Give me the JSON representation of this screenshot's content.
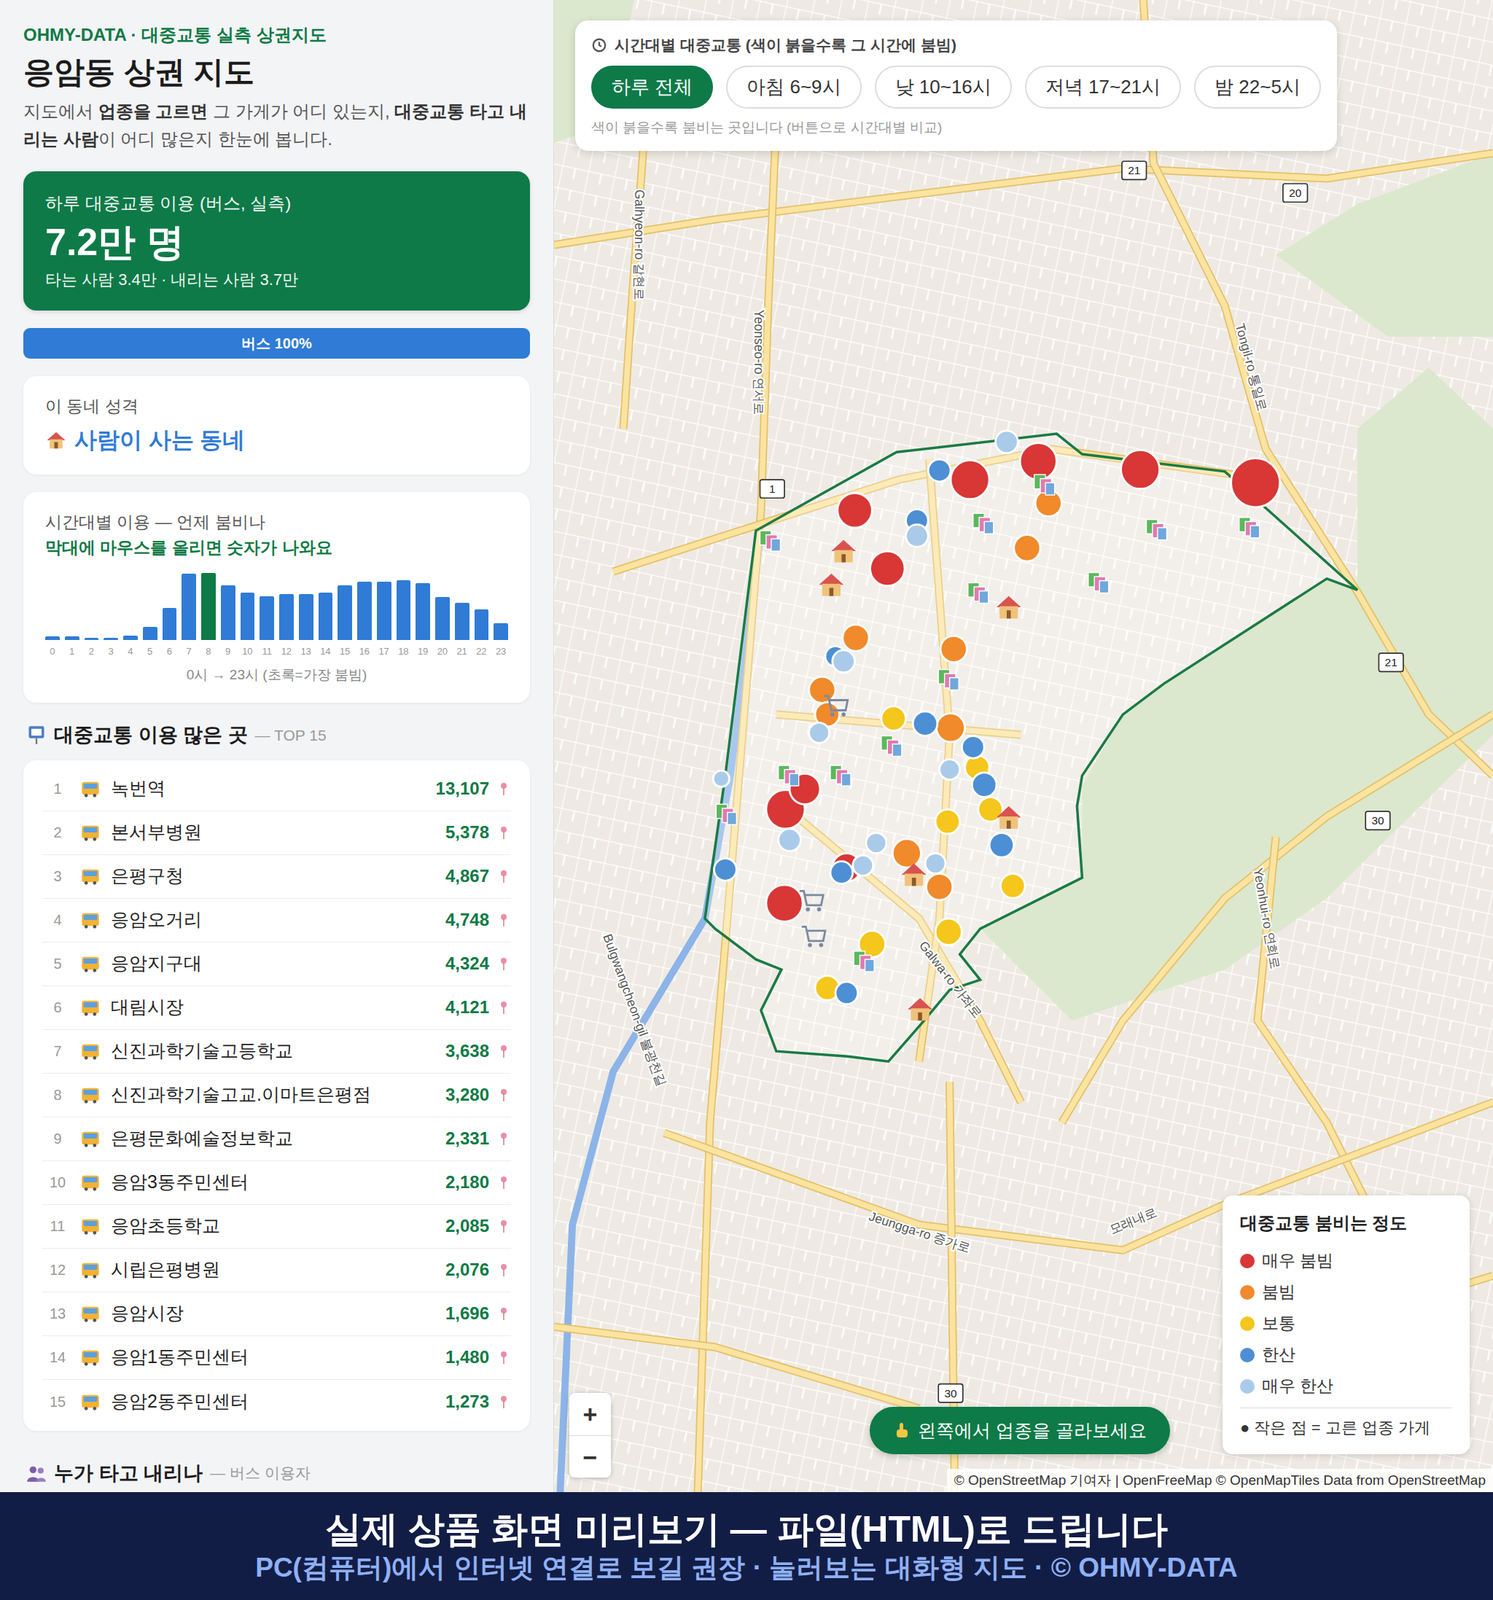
{
  "sidebar": {
    "brand": "OHMY-DATA · 대중교통 실측 상권지도",
    "title": "응암동 상권 지도",
    "description": [
      {
        "text": "지도에서 ",
        "bold": false
      },
      {
        "text": "업종을 고르면",
        "bold": true
      },
      {
        "text": " 그 가게가 어디 있는지, ",
        "bold": false
      },
      {
        "text": "대중교통 타고 내리는 사람",
        "bold": true
      },
      {
        "text": "이 어디 많은지 한눈에 봅니다.",
        "bold": false
      }
    ],
    "summary": {
      "label": "하루 대중교통 이용 (버스, 실측)",
      "value": "7.2만 명",
      "detail": "타는 사람 3.4만 · 내리는 사람 3.7만"
    },
    "mode_share": [
      {
        "label": "버스 100%",
        "level": 1,
        "color": "#2f7bd6"
      }
    ],
    "character": {
      "label": "이 동네 성격",
      "value": "사람이 사는 동네"
    },
    "hourly_chart": {
      "title": "시간대별 이용 — 언제 붐비나",
      "hint": "막대에 마우스를 올리면 숫자가 나와요",
      "bars": [
        {
          "hour": "0",
          "value": 300,
          "peak": false
        },
        {
          "hour": "1",
          "value": 300,
          "peak": false
        },
        {
          "hour": "2",
          "value": 200,
          "peak": false
        },
        {
          "hour": "3",
          "value": 200,
          "peak": false
        },
        {
          "hour": "4",
          "value": 400,
          "peak": false
        },
        {
          "hour": "5",
          "value": 1200,
          "peak": false
        },
        {
          "hour": "6",
          "value": 2900,
          "peak": false
        },
        {
          "hour": "7",
          "value": 6050,
          "peak": false
        },
        {
          "hour": "8",
          "value": 6100,
          "peak": true
        },
        {
          "hour": "9",
          "value": 5000,
          "peak": false
        },
        {
          "hour": "10",
          "value": 4300,
          "peak": false
        },
        {
          "hour": "11",
          "value": 4000,
          "peak": false
        },
        {
          "hour": "12",
          "value": 4200,
          "peak": false
        },
        {
          "hour": "13",
          "value": 4200,
          "peak": false
        },
        {
          "hour": "14",
          "value": 4300,
          "peak": false
        },
        {
          "hour": "15",
          "value": 5000,
          "peak": false
        },
        {
          "hour": "16",
          "value": 5300,
          "peak": false
        },
        {
          "hour": "17",
          "value": 5300,
          "peak": false
        },
        {
          "hour": "18",
          "value": 5450,
          "peak": false
        },
        {
          "hour": "19",
          "value": 5200,
          "peak": false
        },
        {
          "hour": "20",
          "value": 3900,
          "peak": false
        },
        {
          "hour": "21",
          "value": 3400,
          "peak": false
        },
        {
          "hour": "22",
          "value": 2800,
          "peak": false
        },
        {
          "hour": "23",
          "value": 1500,
          "peak": false
        }
      ],
      "caption": "0시 → 23시 (초록=가장 붐빔)"
    },
    "top_stops": {
      "title": "대중교통 이용 많은 곳",
      "subtitle": "— TOP 15",
      "items": [
        {
          "rank": "1",
          "name": "녹번역",
          "count": "13,107"
        },
        {
          "rank": "2",
          "name": "본서부병원",
          "count": "5,378"
        },
        {
          "rank": "3",
          "name": "은평구청",
          "count": "4,867"
        },
        {
          "rank": "4",
          "name": "응암오거리",
          "count": "4,748"
        },
        {
          "rank": "5",
          "name": "응암지구대",
          "count": "4,324"
        },
        {
          "rank": "6",
          "name": "대림시장",
          "count": "4,121"
        },
        {
          "rank": "7",
          "name": "신진과학기술고등학교",
          "count": "3,638"
        },
        {
          "rank": "8",
          "name": "신진과학기술고교.이마트은평점",
          "count": "3,280"
        },
        {
          "rank": "9",
          "name": "은평문화예술정보학교",
          "count": "2,331"
        },
        {
          "rank": "10",
          "name": "응암3동주민센터",
          "count": "2,180"
        },
        {
          "rank": "11",
          "name": "응암초등학교",
          "count": "2,085"
        },
        {
          "rank": "12",
          "name": "시립은평병원",
          "count": "2,076"
        },
        {
          "rank": "13",
          "name": "응암시장",
          "count": "1,696"
        },
        {
          "rank": "14",
          "name": "응암1동주민센터",
          "count": "1,480"
        },
        {
          "rank": "15",
          "name": "응암2동주민센터",
          "count": "1,273"
        }
      ]
    },
    "riders": {
      "title": "누가 타고 내리나",
      "subtitle": "— 버스 이용자"
    }
  },
  "map": {
    "time_filter": {
      "title": "시간대별 대중교통 (색이 붉을수록 그 시간에 붐빔)",
      "options": [
        {
          "label": "하루 전체",
          "selected": true
        },
        {
          "label": "아침 6~9시",
          "selected": false
        },
        {
          "label": "낮 10~16시",
          "selected": false
        },
        {
          "label": "저녁 17~21시",
          "selected": false
        },
        {
          "label": "밤 22~5시",
          "selected": false
        }
      ],
      "note": "색이 붉을수록 붐비는 곳입니다 (버튼으로 시간대별 비교)"
    },
    "stops": [
      {
        "color": "#d93636"
      },
      {
        "color": "#d93636"
      },
      {
        "color": "#d93636"
      },
      {
        "color": "#d93636"
      },
      {
        "color": "#d93636"
      },
      {
        "color": "#d93636"
      },
      {
        "color": "#d93636"
      },
      {
        "color": "#d93636"
      },
      {
        "color": "#d93636"
      },
      {
        "color": "#d93636"
      },
      {
        "color": "#f08a2b"
      },
      {
        "color": "#f08a2b"
      },
      {
        "color": "#f08a2b"
      },
      {
        "color": "#f08a2b"
      },
      {
        "color": "#f08a2b"
      },
      {
        "color": "#f08a2b"
      },
      {
        "color": "#f08a2b"
      },
      {
        "color": "#f08a2b"
      },
      {
        "color": "#f08a2b"
      },
      {
        "color": "#f5c61b"
      },
      {
        "color": "#f5c61b"
      },
      {
        "color": "#f5c61b"
      },
      {
        "color": "#f5c61b"
      },
      {
        "color": "#f5c61b"
      },
      {
        "color": "#f5c61b"
      },
      {
        "color": "#f5c61b"
      },
      {
        "color": "#f5c61b"
      },
      {
        "color": "#4d8fd4"
      },
      {
        "color": "#4d8fd4"
      },
      {
        "color": "#4d8fd4"
      },
      {
        "color": "#4d8fd4"
      },
      {
        "color": "#4d8fd4"
      },
      {
        "color": "#4d8fd4"
      },
      {
        "color": "#4d8fd4"
      },
      {
        "color": "#4d8fd4"
      },
      {
        "color": "#4d8fd4"
      },
      {
        "color": "#4d8fd4"
      },
      {
        "color": "#a9cbe9"
      },
      {
        "color": "#a9cbe9"
      },
      {
        "color": "#a9cbe9"
      },
      {
        "color": "#a9cbe9"
      },
      {
        "color": "#a9cbe9"
      },
      {
        "color": "#a9cbe9"
      },
      {
        "color": "#a9cbe9"
      },
      {
        "color": "#a9cbe9"
      },
      {
        "color": "#a9cbe9"
      },
      {
        "color": "#a9cbe9"
      }
    ],
    "shops": [
      {
        "kind": "book"
      },
      {
        "kind": "book"
      },
      {
        "kind": "book"
      },
      {
        "kind": "book"
      },
      {
        "kind": "book"
      },
      {
        "kind": "book"
      },
      {
        "kind": "book"
      },
      {
        "kind": "book"
      },
      {
        "kind": "book"
      },
      {
        "kind": "book"
      },
      {
        "kind": "book"
      },
      {
        "kind": "book"
      },
      {
        "kind": "book"
      },
      {
        "kind": "house"
      },
      {
        "kind": "house"
      },
      {
        "kind": "house"
      },
      {
        "kind": "house"
      },
      {
        "kind": "house"
      },
      {
        "kind": "house"
      },
      {
        "kind": "cart"
      },
      {
        "kind": "cart"
      },
      {
        "kind": "cart"
      }
    ],
    "road_labels": [
      "Galhyeon-ro 갈현로",
      "Yeonseo-ro 연서로",
      "Tongil-ro 통일로",
      "Yeonhui-ro 연희로",
      "Jeungga-ro 증가로",
      "모래내로",
      "Bulgwangcheon-gil 불광천길",
      "Galwa-ro 가좌로"
    ],
    "route_numbers": [
      "21",
      "20",
      "1",
      "21",
      "30",
      "30"
    ],
    "legend": {
      "title": "대중교통 붐비는 정도",
      "items": [
        {
          "label": "매우 붐빔",
          "color": "#d93636"
        },
        {
          "label": "붐빔",
          "color": "#f08a2b"
        },
        {
          "label": "보통",
          "color": "#f5c61b"
        },
        {
          "label": "한산",
          "color": "#4d8fd4"
        },
        {
          "label": "매우 한산",
          "color": "#a9cbe9"
        }
      ],
      "footnote": "● 작은 점 = 고른 업종 가게"
    },
    "zoom": [
      "+",
      "−"
    ],
    "hint_button": "왼쪽에서 업종을 골라보세요",
    "attribution": "© OpenStreetMap 기여자 | OpenFreeMap © OpenMapTiles Data from OpenStreetMap"
  },
  "banner": {
    "title": "실제 상품 화면 미리보기 — 파일(HTML)로 드립니다",
    "subtitle": "PC(컴퓨터)에서 인터넷 연결로 보길 권장 · 눌러보는 대화형 지도 · © OHMY-DATA"
  }
}
